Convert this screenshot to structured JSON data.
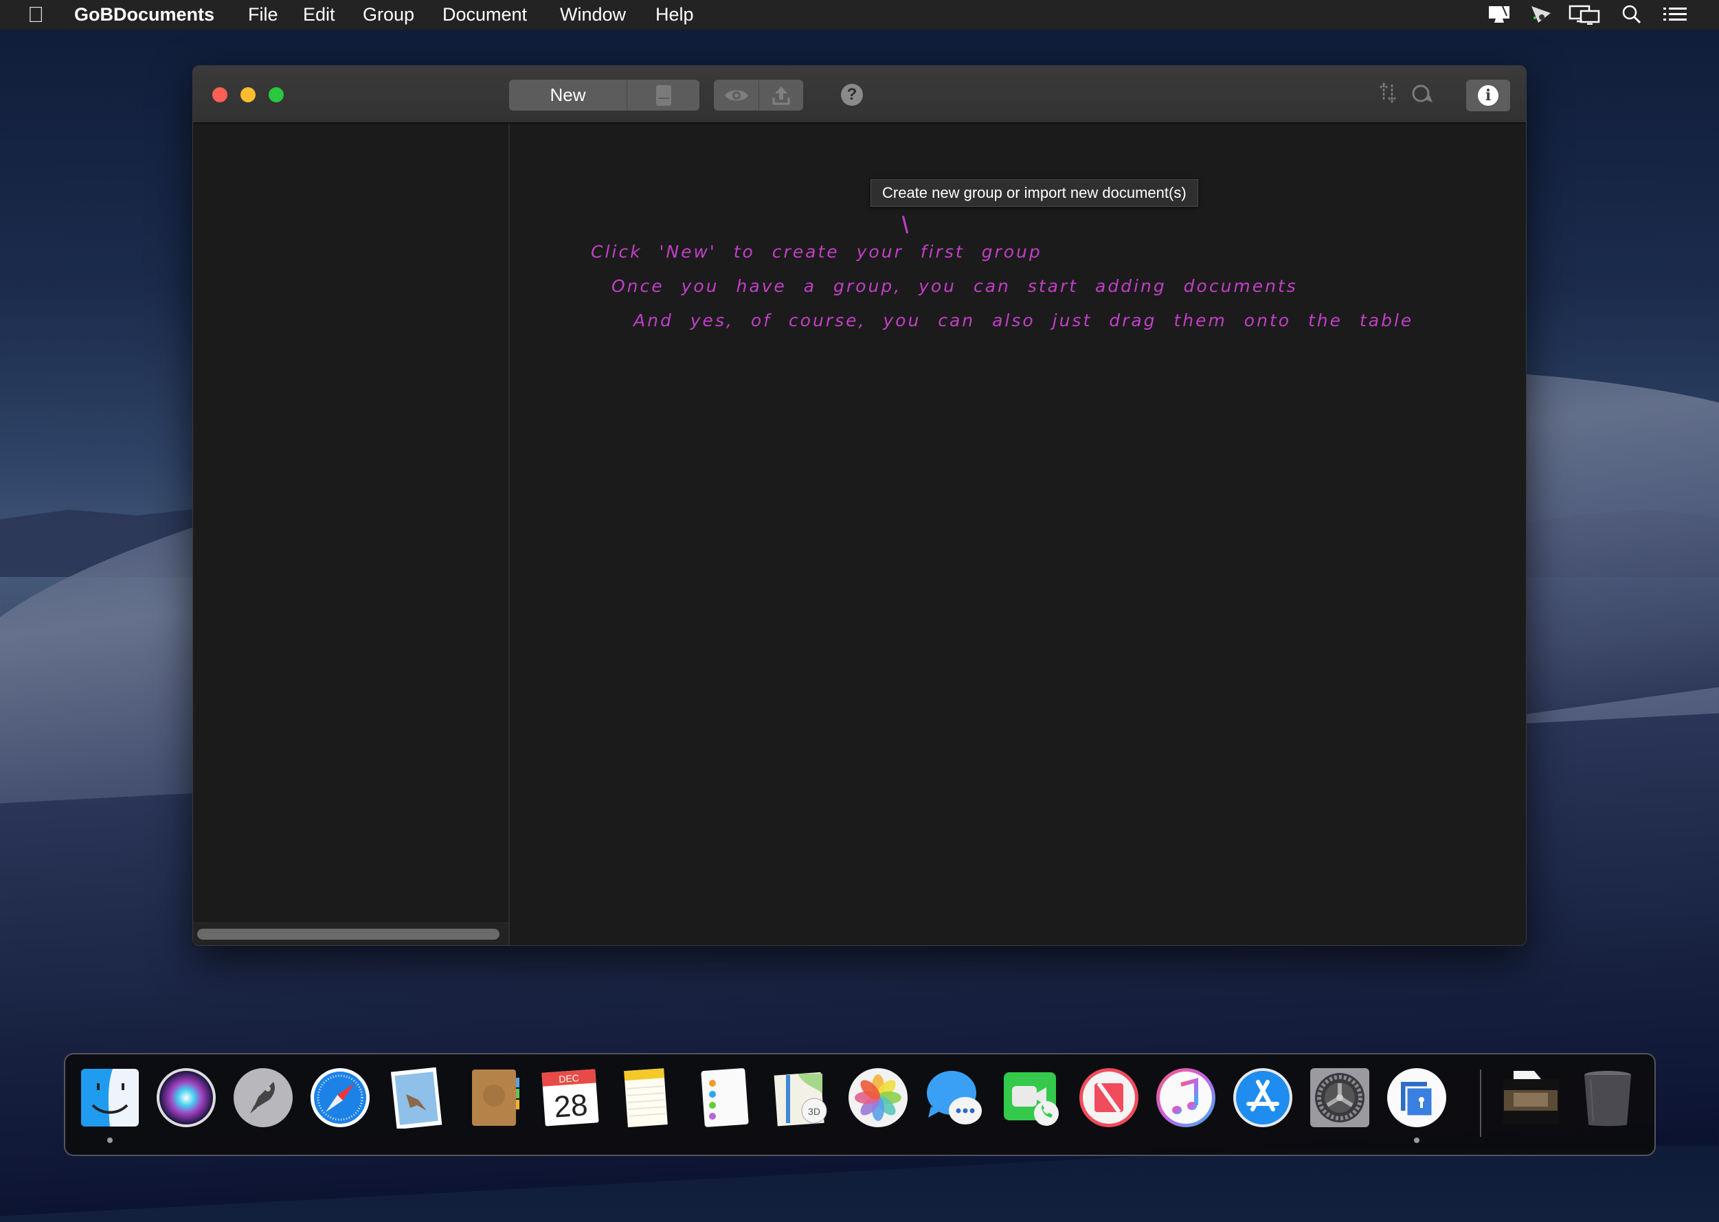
{
  "menubar": {
    "apple_icon": "apple-logo-icon",
    "app_name": "GoBDocuments",
    "items": [
      "File",
      "Edit",
      "Group",
      "Document",
      "Window",
      "Help"
    ],
    "status_icons": [
      "cleanmymac-menu-icon",
      "screenflow-menu-icon",
      "display-mirroring-icon",
      "spotlight-search-icon",
      "notification-center-icon"
    ]
  },
  "window": {
    "traffic_lights": {
      "close": "#ff5f57",
      "minimize": "#febc2e",
      "zoom": "#28c840"
    },
    "toolbar": {
      "new_label": "New",
      "sidebar_toggle_icon": "sidebar-toggle-icon",
      "preview_icon": "eye-icon",
      "share_icon": "share-upload-icon",
      "help_label": "?",
      "sort_icon": "sort-arrows-icon",
      "search_icon": "search-icon",
      "info_label": "i"
    },
    "tooltip": "Create new group or import new document(s)",
    "hint": {
      "color": "#c23fc6",
      "lines": [
        "Click 'New' to create your first group",
        "Once you have a group, you can start adding documents",
        "And yes, of course, you can also just drag them onto the table"
      ]
    }
  },
  "dock": {
    "apps": [
      {
        "name": "Finder",
        "running": true
      },
      {
        "name": "Siri",
        "running": false
      },
      {
        "name": "Launchpad",
        "running": false
      },
      {
        "name": "Safari",
        "running": false
      },
      {
        "name": "Mail",
        "running": false
      },
      {
        "name": "Contacts",
        "running": false
      },
      {
        "name": "Calendar",
        "running": false,
        "month": "DEC",
        "day": "28"
      },
      {
        "name": "Notes",
        "running": false
      },
      {
        "name": "Reminders",
        "running": false
      },
      {
        "name": "Maps",
        "running": false,
        "badge": "3D"
      },
      {
        "name": "Photos",
        "running": false
      },
      {
        "name": "Messages",
        "running": false
      },
      {
        "name": "FaceTime",
        "running": false
      },
      {
        "name": "News",
        "running": false
      },
      {
        "name": "iTunes",
        "running": false
      },
      {
        "name": "App Store",
        "running": false
      },
      {
        "name": "System Preferences",
        "running": false
      },
      {
        "name": "GoBDocuments",
        "running": true
      }
    ],
    "others": [
      "Downloads stack",
      "Trash"
    ]
  }
}
